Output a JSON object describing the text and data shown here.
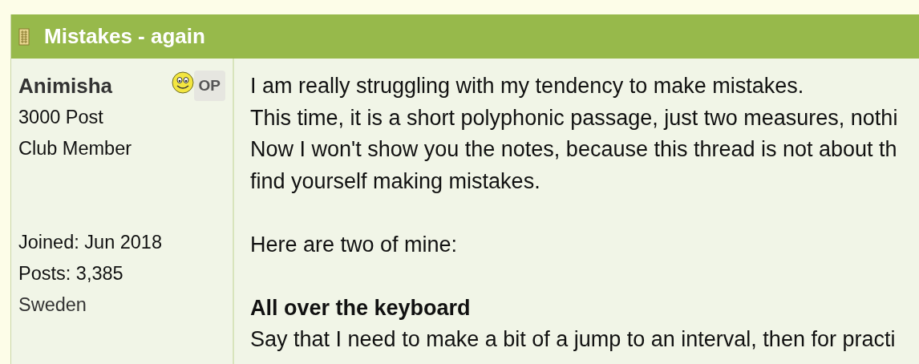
{
  "thread": {
    "title": "Mistakes - again"
  },
  "author": {
    "name": "Animisha",
    "badge": "OP",
    "rank": "3000 Post",
    "group": "Club Member",
    "joined": "Joined: Jun 2018",
    "posts": "Posts: 3,385",
    "location": "Sweden"
  },
  "post": {
    "blocks": [
      {
        "kind": "text",
        "lines": [
          "I am really struggling with my tendency to make mistakes.",
          "This time, it is a short polyphonic passage, just two measures, nothi",
          "Now I won't show you the notes, because this thread is not about th",
          "find yourself making mistakes."
        ]
      },
      {
        "kind": "text",
        "lines": [
          "Here are two of mine:"
        ]
      },
      {
        "kind": "heading",
        "lines": [
          "All over the keyboard"
        ]
      },
      {
        "kind": "text",
        "lines": [
          "Say that I need to make a bit of a jump to an interval, then for practi"
        ]
      }
    ]
  }
}
